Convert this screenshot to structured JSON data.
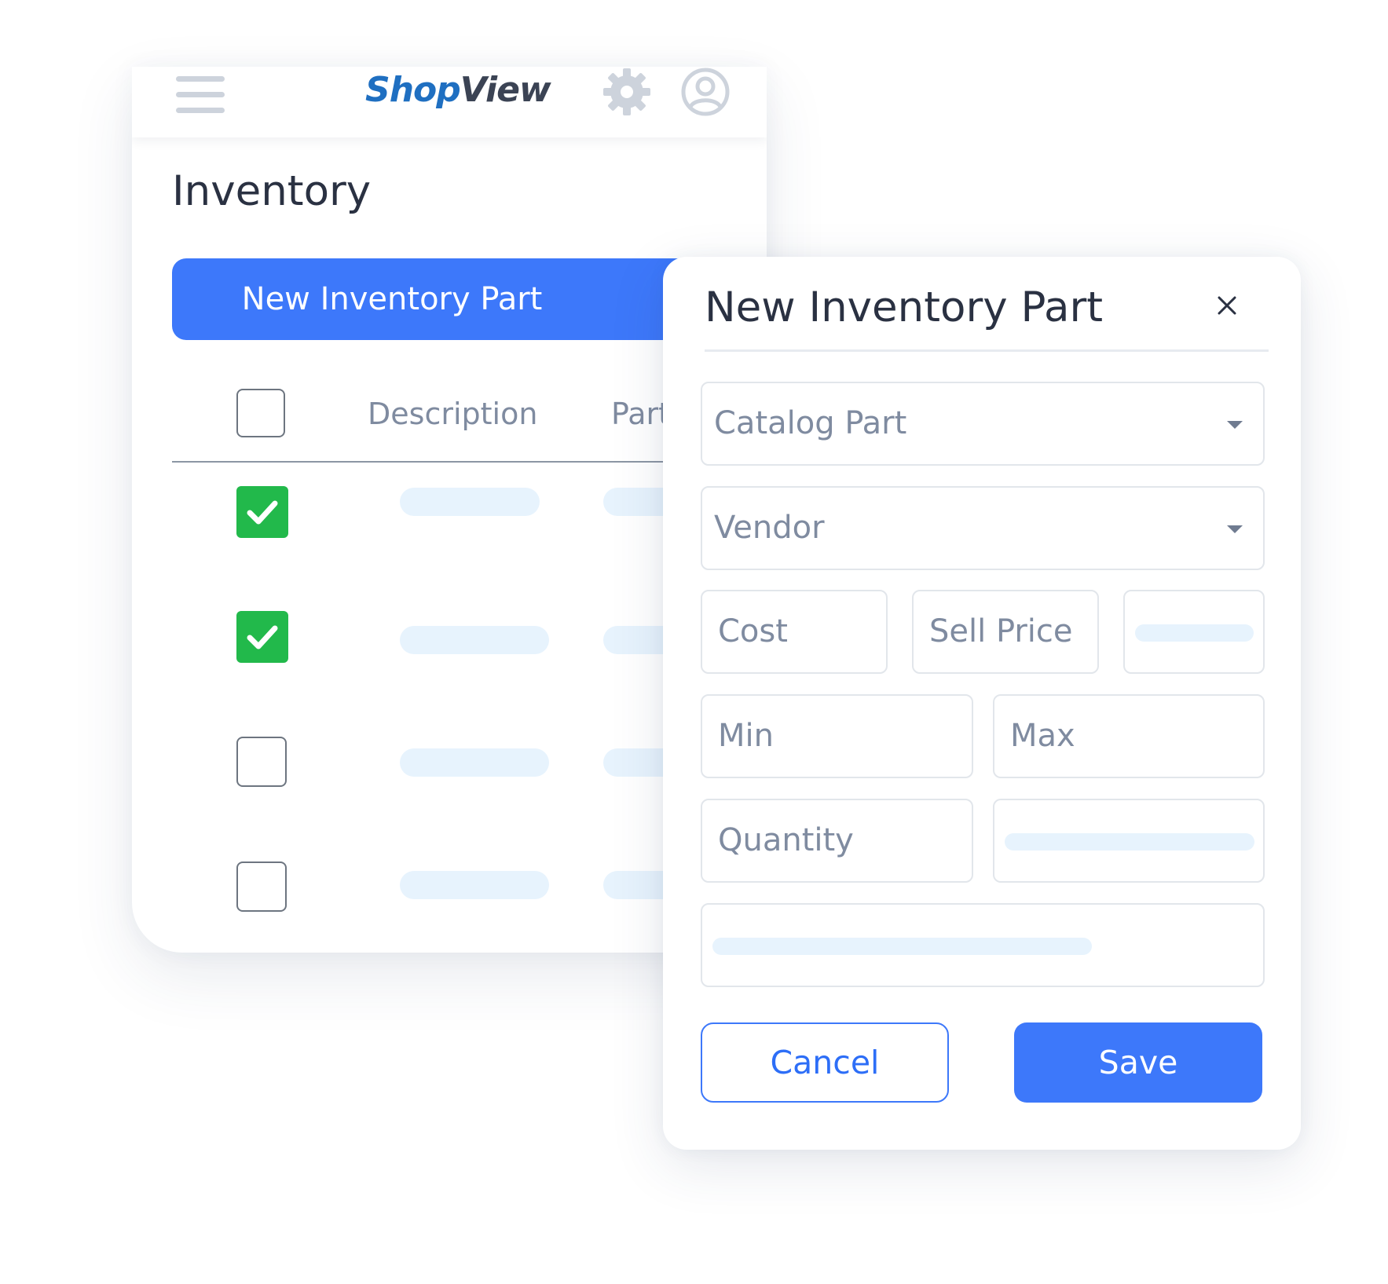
{
  "app": {
    "logo_part1": "Shop",
    "logo_part2": "View"
  },
  "page": {
    "title": "Inventory",
    "new_button_label": "New Inventory Part"
  },
  "table": {
    "columns": [
      "Description",
      "Part"
    ],
    "rows": [
      {
        "checked": true
      },
      {
        "checked": true
      },
      {
        "checked": false
      },
      {
        "checked": false
      }
    ]
  },
  "modal": {
    "title": "New Inventory Part",
    "close_icon": "close-icon",
    "fields": {
      "catalog_part": "Catalog Part",
      "vendor": "Vendor",
      "cost": "Cost",
      "sell_price": "Sell Price",
      "min": "Min",
      "max": "Max",
      "quantity": "Quantity"
    },
    "cancel_label": "Cancel",
    "save_label": "Save"
  },
  "icons": [
    "hamburger-icon",
    "gear-icon",
    "user-avatar-icon",
    "checkmark-icon",
    "dropdown-caret-icon",
    "close-icon"
  ],
  "colors": {
    "primary": "#3d78fa",
    "checked": "#22b94b",
    "logo_blue": "#1f6fc1",
    "logo_dark": "#3b4354",
    "placeholder": "#e7f3fd"
  }
}
